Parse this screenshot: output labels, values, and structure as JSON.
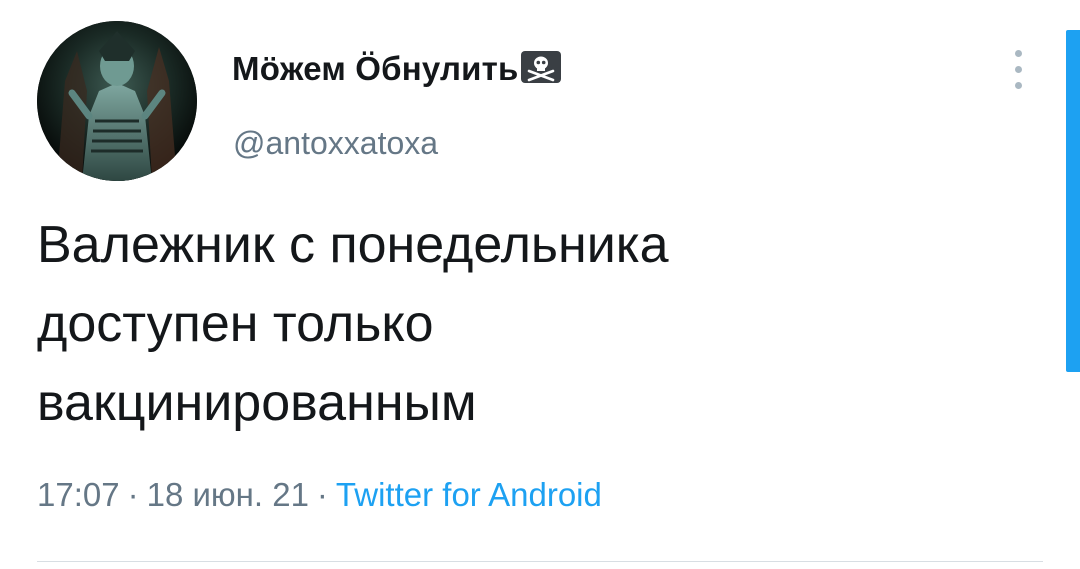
{
  "tweet": {
    "author": {
      "display_name": "Мӧжем Ӧбнулить",
      "badge_emoji": "skull-and-crossbones-icon",
      "handle": "@antoxxatoxa"
    },
    "text": "Валежник с понедельника\nдоступен только\nвакцинированным",
    "time": "17:07",
    "separator": "·",
    "date": "18 июн. 21",
    "source": "Twitter for Android"
  },
  "colors": {
    "text": "#14171a",
    "secondary": "#657786",
    "link": "#1da1f2",
    "divider": "#d8dee3"
  }
}
